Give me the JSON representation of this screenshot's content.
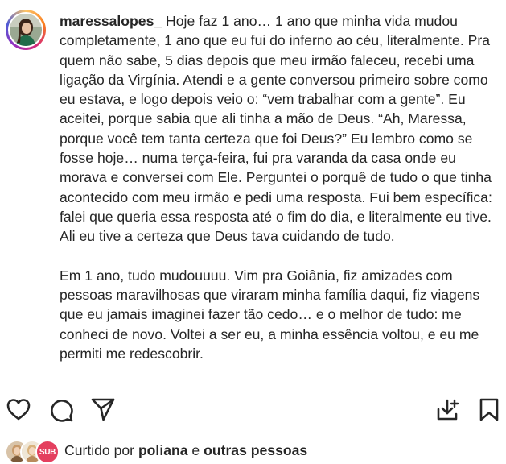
{
  "post": {
    "username": "maressalopes_",
    "caption": {
      "paragraph1": "Hoje faz 1 ano… 1 ano que minha vida mudou completamente, 1 ano que eu fui do inferno ao céu, literalmente. Pra quem não sabe, 5 dias depois que meu irmão faleceu, recebi uma ligação da Virgínia. Atendi e a gente conversou primeiro sobre como eu estava, e logo depois veio o: “vem trabalhar com a gente”. Eu aceitei, porque sabia que ali tinha a mão de Deus. “Ah, Maressa, porque você tem tanta certeza que foi Deus?” Eu lembro como se fosse hoje… numa terça-feira, fui pra varanda da casa onde eu morava e conversei com Ele. Perguntei o porquê de tudo o que tinha acontecido com meu irmão e pedi uma resposta. Fui bem específica: falei que queria essa resposta até o fim do dia, e literalmente eu tive. Ali eu tive a certeza que Deus tava cuidando de tudo.",
      "paragraph2": "Em 1 ano, tudo mudouuuu. Vim pra Goiânia, fiz amizades com pessoas maravilhosas que viraram minha família daqui, fiz viagens que eu jamais imaginei fazer tão cedo… e o melhor de tudo: me conheci de novo. Voltei a ser eu, a minha essência voltou, e eu me permiti me redescobrir."
    }
  },
  "actions": {
    "like_icon": "heart-outline-icon",
    "comment_icon": "comment-bubble-icon",
    "share_icon": "paper-plane-icon",
    "download_icon": "download-tray-icon",
    "save_icon": "bookmark-outline-icon"
  },
  "likes": {
    "prefix": "Curtido por",
    "first_liker": "poliana",
    "joiner": "e",
    "others": "outras pessoas",
    "badge_text": "SUB"
  },
  "colors": {
    "text": "#262626",
    "ring_start": "#fdc468",
    "ring_mid": "#d62976",
    "ring_end": "#4f5bd5",
    "badge": "#e4405f"
  }
}
